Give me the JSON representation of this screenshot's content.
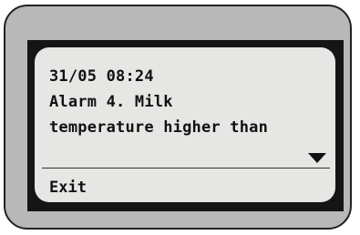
{
  "display": {
    "line1": "31/05 08:24",
    "line2": "Alarm 4. Milk",
    "line3": "temperature higher than",
    "scroll_indicator_icon": "triangle-down-icon",
    "exit_label": "Exit"
  },
  "colors": {
    "device_body": "#b8b8b8",
    "bezel": "#151515",
    "screen_background": "#e6e6e4",
    "text": "#111111"
  }
}
